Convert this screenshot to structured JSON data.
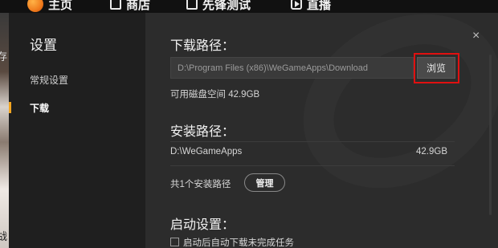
{
  "topnav": {
    "items": [
      {
        "label": "主页",
        "icon": "wegame-logo-icon"
      },
      {
        "label": "商店",
        "icon": "store-icon"
      },
      {
        "label": "先锋测试",
        "icon": "test-icon"
      },
      {
        "label": "直播",
        "icon": "play-icon"
      }
    ]
  },
  "background": {
    "chars": [
      "存",
      "战"
    ]
  },
  "dialog": {
    "close_glyph": "×",
    "sidebar": {
      "title": "设置",
      "items": [
        {
          "label": "常规设置"
        },
        {
          "label": "下载"
        }
      ]
    },
    "download": {
      "title": "下载路径：",
      "path": "D:\\Program Files (x86)\\WeGameApps\\Download",
      "browse_label": "浏览",
      "free_space": "可用磁盘空间 42.9GB"
    },
    "install": {
      "title": "安装路径：",
      "path": "D:\\WeGameApps",
      "size": "42.9GB",
      "count_text": "共1个安装路径",
      "manage_label": "管理"
    },
    "startup": {
      "title": "启动设置：",
      "option_label": "启动后自动下载未完成任务"
    }
  },
  "colors": {
    "accent": "#f3a521",
    "highlight": "#e01010",
    "dialog_bg": "#2c2c2c",
    "sidebar_bg": "#1f1f1f"
  }
}
